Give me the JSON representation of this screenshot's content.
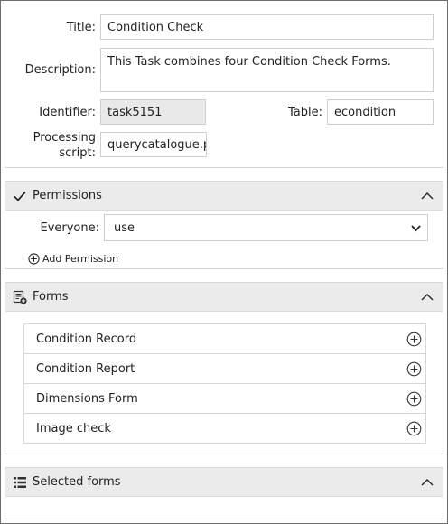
{
  "details": {
    "title_label": "Title:",
    "title_value": "Condition Check",
    "description_label": "Description:",
    "description_value": "This Task combines four Condition Check Forms.",
    "identifier_label": "Identifier:",
    "identifier_value": "task5151",
    "table_label": "Table:",
    "table_value": "econdition",
    "processing_label_line1": "Processing",
    "processing_label_line2": "script:",
    "processing_value": "querycatalogue.pl"
  },
  "permissions": {
    "header": "Permissions",
    "header_icon": "checkmark-icon",
    "everyone_label": "Everyone:",
    "everyone_value": "use",
    "add_label": "Add Permission"
  },
  "forms": {
    "header": "Forms",
    "header_icon": "form-add-icon",
    "items": [
      {
        "label": "Condition Record"
      },
      {
        "label": "Condition Report"
      },
      {
        "label": "Dimensions Form"
      },
      {
        "label": "Image check"
      }
    ]
  },
  "selected_forms": {
    "header": "Selected forms",
    "header_icon": "list-icon"
  }
}
